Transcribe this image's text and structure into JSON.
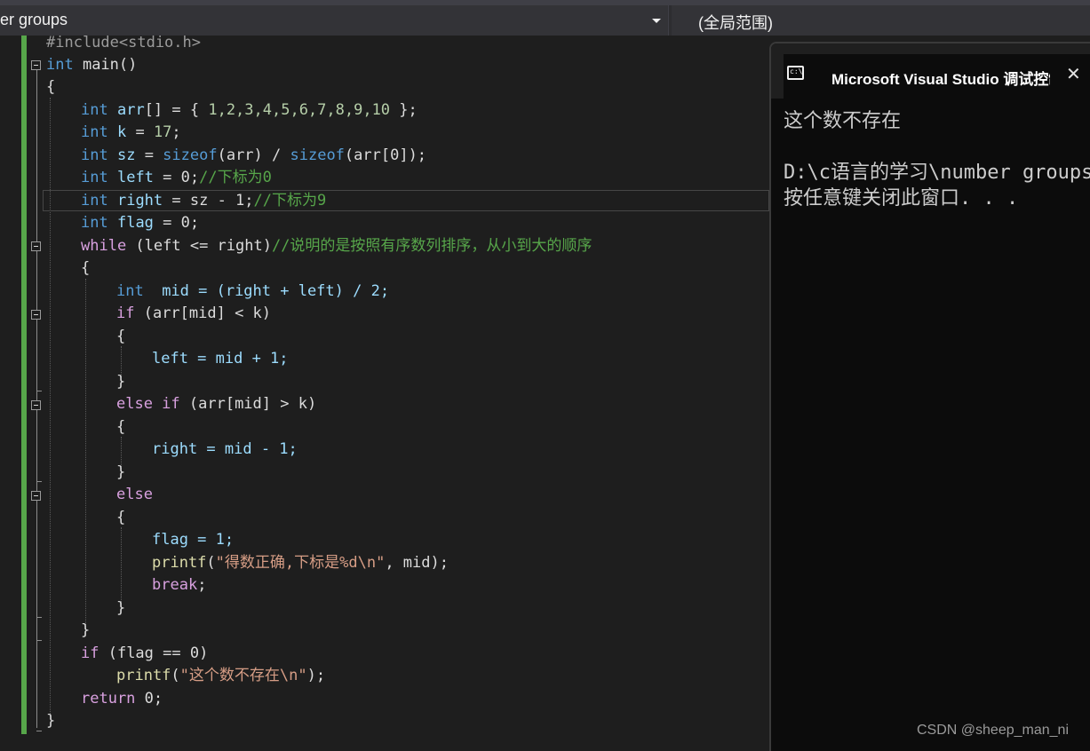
{
  "nav": {
    "left_scope": "er groups",
    "right_scope": "(全局范围)"
  },
  "code": {
    "l1": "#include<stdio.h>",
    "l2_kw": "int",
    "l2_rest": " main()",
    "l3": "{",
    "l4_kw": "int",
    "l4_id": "arr",
    "l4_rest1": "[] = { ",
    "l4_nums": "1,2,3,4,5,6,7,8,9,10",
    "l4_rest2": " };",
    "l5_kw": "int",
    "l5_id": "k",
    "l5_rest": " = ",
    "l5_num": "17",
    "l5_end": ";",
    "l6_kw": "int",
    "l6_id": "sz",
    "l6_eq": " = ",
    "l6_sizeof1": "sizeof",
    "l6_arg1": "(arr)",
    "l6_div": " / ",
    "l6_sizeof2": "sizeof",
    "l6_arg2": "(arr[0]);",
    "l7_kw": "int",
    "l7_id": "left",
    "l7_rest": " = 0;",
    "l7_cmt": "//下标为0",
    "l8_kw": "int",
    "l8_id": "right",
    "l8_rest": " = sz - 1;",
    "l8_cmt": "//下标为9",
    "l9_kw": "int",
    "l9_id": "flag",
    "l9_rest": " = 0;",
    "l10_kw": "while",
    "l10_rest": " (left <= right)",
    "l10_cmt": "//说明的是按照有序数列排序，从小到大的顺序",
    "l11": "{",
    "l12_kw": "int",
    "l12_rest": "  mid = (right + left) / 2;",
    "l13_kw": "if",
    "l13_rest": " (arr[mid] < k)",
    "l14": "{",
    "l15": "left = mid + 1;",
    "l16": "}",
    "l17_kw": "else if",
    "l17_rest": " (arr[mid] > k)",
    "l18": "{",
    "l19": "right = mid - 1;",
    "l20": "}",
    "l21_kw": "else",
    "l22": "{",
    "l23": "flag = 1;",
    "l24_fn": "printf",
    "l24_open": "(",
    "l24_str": "\"得数正确,下标是%d\\n\"",
    "l24_rest": ", mid);",
    "l25_kw": "break",
    "l25_rest": ";",
    "l26": "}",
    "l27": "}",
    "l28_kw": "if",
    "l28_rest": " (flag == 0)",
    "l29_fn": "printf",
    "l29_open": "(",
    "l29_str": "\"这个数不存在\\n\"",
    "l29_rest": ");",
    "l30_kw": "return",
    "l30_rest": " 0;",
    "l31": "}"
  },
  "console": {
    "tab_title": "Microsoft Visual Studio 调试控制台",
    "close_glyph": "✕",
    "out1": "这个数不存在",
    "out2": "D:\\c语言的学习\\number groups",
    "out3": "按任意键关闭此窗口. . ."
  },
  "watermark": "CSDN @sheep_man_ni",
  "colors": {
    "keyword": "#569cd6",
    "control": "#d8a0df",
    "identifier": "#9cdcfe",
    "function": "#dcdcaa",
    "number": "#b5cea8",
    "string": "#d69d85",
    "comment": "#57a64a"
  }
}
